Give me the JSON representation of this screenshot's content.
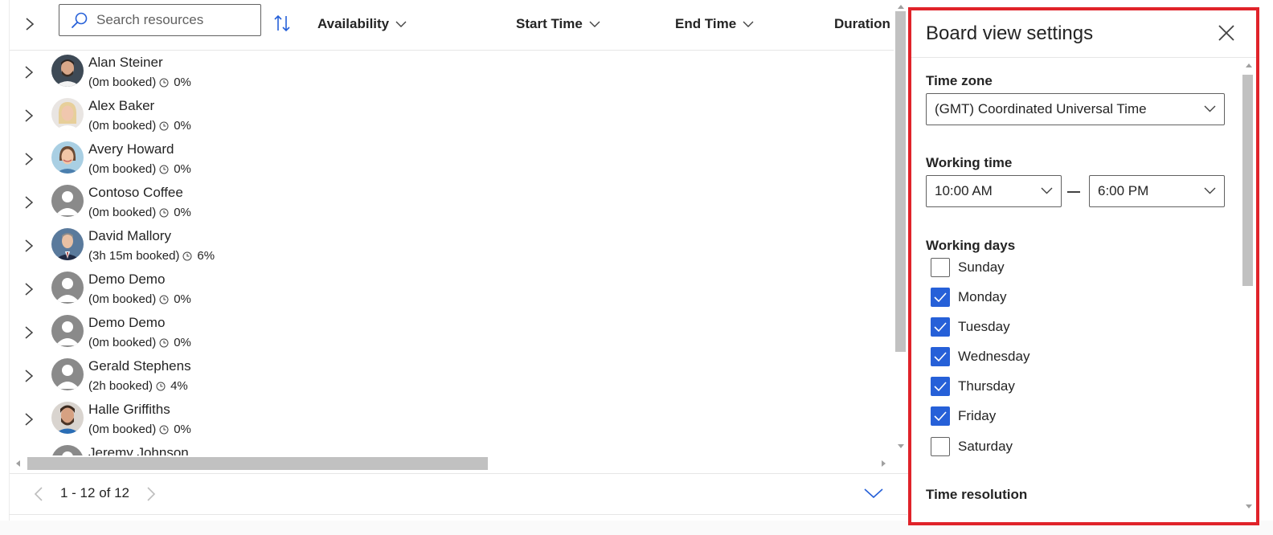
{
  "board": {
    "search_placeholder": "Search resources",
    "columns": {
      "availability": "Availability",
      "start_time": "Start Time",
      "end_time": "End Time",
      "duration": "Duration"
    },
    "resources": [
      {
        "name": "Alan Steiner",
        "booked": "(0m booked)",
        "pct": "0%",
        "avatar": "photo-man-beard"
      },
      {
        "name": "Alex Baker",
        "booked": "(0m booked)",
        "pct": "0%",
        "avatar": "photo-woman-blonde"
      },
      {
        "name": "Avery Howard",
        "booked": "(0m booked)",
        "pct": "0%",
        "avatar": "photo-woman-smile"
      },
      {
        "name": "Contoso Coffee",
        "booked": "(0m booked)",
        "pct": "0%",
        "avatar": "default-person"
      },
      {
        "name": "David Mallory",
        "booked": "(3h 15m booked)",
        "pct": "6%",
        "avatar": "photo-man-suit"
      },
      {
        "name": "Demo Demo",
        "booked": "(0m booked)",
        "pct": "0%",
        "avatar": "default-person"
      },
      {
        "name": "Demo Demo",
        "booked": "(0m booked)",
        "pct": "0%",
        "avatar": "default-person"
      },
      {
        "name": "Gerald Stephens",
        "booked": "(2h booked)",
        "pct": "4%",
        "avatar": "default-person"
      },
      {
        "name": "Halle Griffiths",
        "booked": "(0m booked)",
        "pct": "0%",
        "avatar": "photo-man-beard-2"
      },
      {
        "name": "Jeremy Johnson",
        "booked": "",
        "pct": "",
        "avatar": "default-person"
      }
    ],
    "pager": {
      "range": "1 - 12 of 12"
    }
  },
  "settings": {
    "title": "Board view settings",
    "time_zone_label": "Time zone",
    "time_zone_value": "(GMT) Coordinated Universal Time",
    "working_time_label": "Working time",
    "working_time_start": "10:00 AM",
    "working_time_end": "6:00 PM",
    "working_days_label": "Working days",
    "days": [
      {
        "label": "Sunday",
        "checked": false
      },
      {
        "label": "Monday",
        "checked": true
      },
      {
        "label": "Tuesday",
        "checked": true
      },
      {
        "label": "Wednesday",
        "checked": true
      },
      {
        "label": "Thursday",
        "checked": true
      },
      {
        "label": "Friday",
        "checked": true
      },
      {
        "label": "Saturday",
        "checked": false
      }
    ],
    "time_resolution_label": "Time resolution"
  },
  "colors": {
    "accent": "#2660d8",
    "highlight_border": "#e0232a",
    "scrollbar": "#c1c1c1"
  },
  "icons": [
    "chevron-right-icon",
    "search-icon",
    "sort-icon",
    "chevron-down-icon",
    "clock-icon",
    "close-icon",
    "check-icon",
    "chevron-left-icon"
  ]
}
